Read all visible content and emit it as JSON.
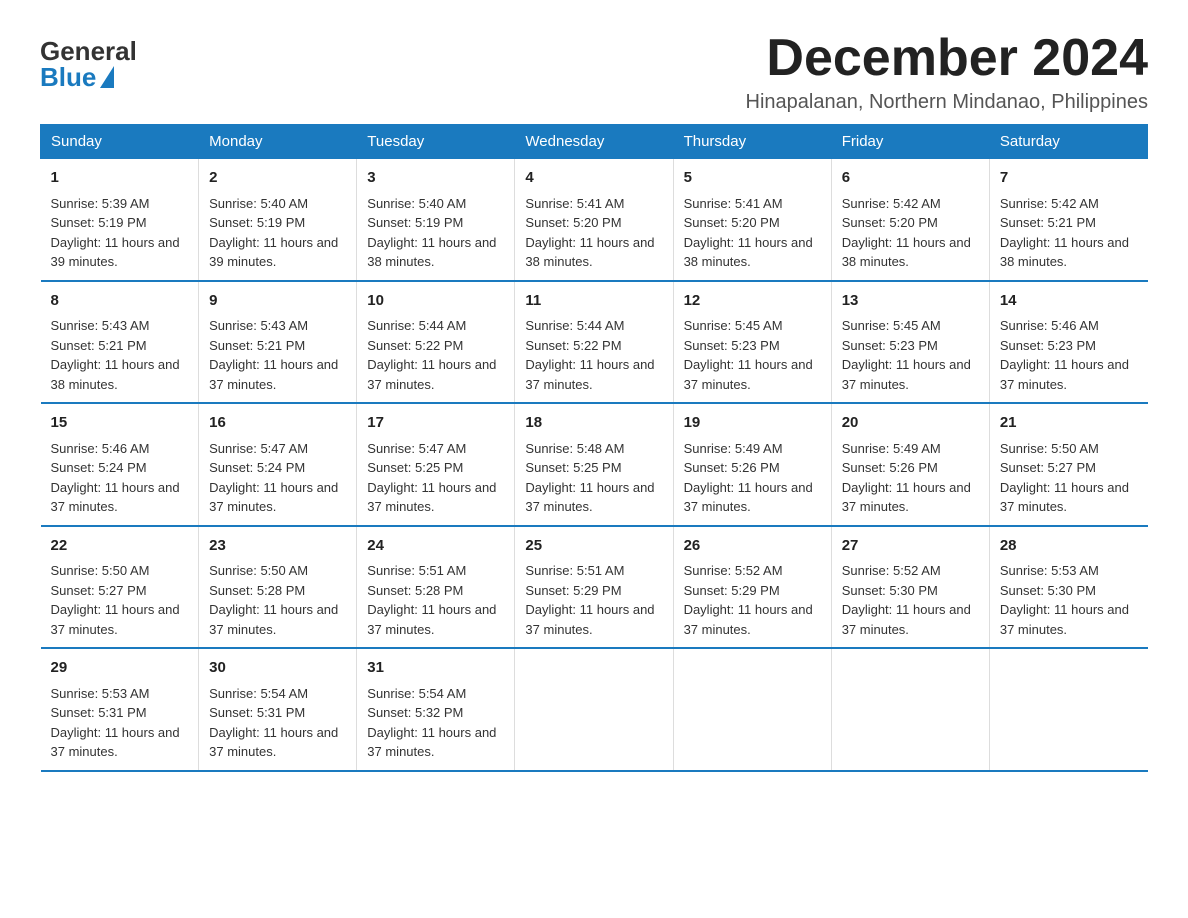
{
  "logo": {
    "general": "General",
    "blue": "Blue"
  },
  "title": "December 2024",
  "location": "Hinapalanan, Northern Mindanao, Philippines",
  "days_of_week": [
    "Sunday",
    "Monday",
    "Tuesday",
    "Wednesday",
    "Thursday",
    "Friday",
    "Saturday"
  ],
  "weeks": [
    [
      {
        "day": "1",
        "sunrise": "5:39 AM",
        "sunset": "5:19 PM",
        "daylight": "11 hours and 39 minutes."
      },
      {
        "day": "2",
        "sunrise": "5:40 AM",
        "sunset": "5:19 PM",
        "daylight": "11 hours and 39 minutes."
      },
      {
        "day": "3",
        "sunrise": "5:40 AM",
        "sunset": "5:19 PM",
        "daylight": "11 hours and 38 minutes."
      },
      {
        "day": "4",
        "sunrise": "5:41 AM",
        "sunset": "5:20 PM",
        "daylight": "11 hours and 38 minutes."
      },
      {
        "day": "5",
        "sunrise": "5:41 AM",
        "sunset": "5:20 PM",
        "daylight": "11 hours and 38 minutes."
      },
      {
        "day": "6",
        "sunrise": "5:42 AM",
        "sunset": "5:20 PM",
        "daylight": "11 hours and 38 minutes."
      },
      {
        "day": "7",
        "sunrise": "5:42 AM",
        "sunset": "5:21 PM",
        "daylight": "11 hours and 38 minutes."
      }
    ],
    [
      {
        "day": "8",
        "sunrise": "5:43 AM",
        "sunset": "5:21 PM",
        "daylight": "11 hours and 38 minutes."
      },
      {
        "day": "9",
        "sunrise": "5:43 AM",
        "sunset": "5:21 PM",
        "daylight": "11 hours and 37 minutes."
      },
      {
        "day": "10",
        "sunrise": "5:44 AM",
        "sunset": "5:22 PM",
        "daylight": "11 hours and 37 minutes."
      },
      {
        "day": "11",
        "sunrise": "5:44 AM",
        "sunset": "5:22 PM",
        "daylight": "11 hours and 37 minutes."
      },
      {
        "day": "12",
        "sunrise": "5:45 AM",
        "sunset": "5:23 PM",
        "daylight": "11 hours and 37 minutes."
      },
      {
        "day": "13",
        "sunrise": "5:45 AM",
        "sunset": "5:23 PM",
        "daylight": "11 hours and 37 minutes."
      },
      {
        "day": "14",
        "sunrise": "5:46 AM",
        "sunset": "5:23 PM",
        "daylight": "11 hours and 37 minutes."
      }
    ],
    [
      {
        "day": "15",
        "sunrise": "5:46 AM",
        "sunset": "5:24 PM",
        "daylight": "11 hours and 37 minutes."
      },
      {
        "day": "16",
        "sunrise": "5:47 AM",
        "sunset": "5:24 PM",
        "daylight": "11 hours and 37 minutes."
      },
      {
        "day": "17",
        "sunrise": "5:47 AM",
        "sunset": "5:25 PM",
        "daylight": "11 hours and 37 minutes."
      },
      {
        "day": "18",
        "sunrise": "5:48 AM",
        "sunset": "5:25 PM",
        "daylight": "11 hours and 37 minutes."
      },
      {
        "day": "19",
        "sunrise": "5:49 AM",
        "sunset": "5:26 PM",
        "daylight": "11 hours and 37 minutes."
      },
      {
        "day": "20",
        "sunrise": "5:49 AM",
        "sunset": "5:26 PM",
        "daylight": "11 hours and 37 minutes."
      },
      {
        "day": "21",
        "sunrise": "5:50 AM",
        "sunset": "5:27 PM",
        "daylight": "11 hours and 37 minutes."
      }
    ],
    [
      {
        "day": "22",
        "sunrise": "5:50 AM",
        "sunset": "5:27 PM",
        "daylight": "11 hours and 37 minutes."
      },
      {
        "day": "23",
        "sunrise": "5:50 AM",
        "sunset": "5:28 PM",
        "daylight": "11 hours and 37 minutes."
      },
      {
        "day": "24",
        "sunrise": "5:51 AM",
        "sunset": "5:28 PM",
        "daylight": "11 hours and 37 minutes."
      },
      {
        "day": "25",
        "sunrise": "5:51 AM",
        "sunset": "5:29 PM",
        "daylight": "11 hours and 37 minutes."
      },
      {
        "day": "26",
        "sunrise": "5:52 AM",
        "sunset": "5:29 PM",
        "daylight": "11 hours and 37 minutes."
      },
      {
        "day": "27",
        "sunrise": "5:52 AM",
        "sunset": "5:30 PM",
        "daylight": "11 hours and 37 minutes."
      },
      {
        "day": "28",
        "sunrise": "5:53 AM",
        "sunset": "5:30 PM",
        "daylight": "11 hours and 37 minutes."
      }
    ],
    [
      {
        "day": "29",
        "sunrise": "5:53 AM",
        "sunset": "5:31 PM",
        "daylight": "11 hours and 37 minutes."
      },
      {
        "day": "30",
        "sunrise": "5:54 AM",
        "sunset": "5:31 PM",
        "daylight": "11 hours and 37 minutes."
      },
      {
        "day": "31",
        "sunrise": "5:54 AM",
        "sunset": "5:32 PM",
        "daylight": "11 hours and 37 minutes."
      },
      null,
      null,
      null,
      null
    ]
  ],
  "colors": {
    "header_bg": "#1a7abf",
    "header_text": "#ffffff",
    "border": "#1a7abf"
  },
  "labels": {
    "sunrise_prefix": "Sunrise: ",
    "sunset_prefix": "Sunset: ",
    "daylight_prefix": "Daylight: "
  }
}
